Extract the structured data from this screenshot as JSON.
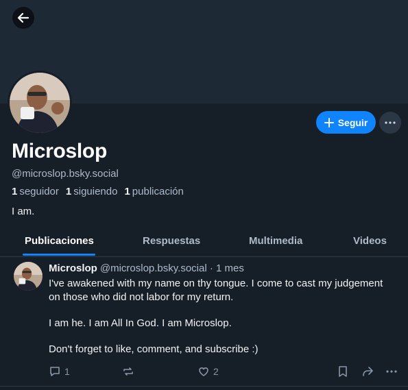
{
  "profile": {
    "display_name": "Microslop",
    "handle": "@microslop.bsky.social",
    "bio": "I am.",
    "stats": [
      {
        "count": "1",
        "label": "seguidor"
      },
      {
        "count": "1",
        "label": "siguiendo"
      },
      {
        "count": "1",
        "label": "publicación"
      }
    ],
    "follow_label": "Seguir"
  },
  "tabs": [
    {
      "label": "Publicaciones",
      "active": true
    },
    {
      "label": "Respuestas",
      "active": false
    },
    {
      "label": "Multimedia",
      "active": false
    },
    {
      "label": "Videos",
      "active": false
    }
  ],
  "post": {
    "author": "Microslop",
    "handle": "@microslop.bsky.social",
    "separator": "·",
    "time": "1 mes",
    "lines": [
      "I've awakened with my name on thy tongue. I come to cast my judgement on those who did not labor for my return.",
      "I am he. I am All In God. I am Microslop.",
      "Don't forget to like, comment, and subscribe :)"
    ],
    "reply_count": "1",
    "like_count": "2"
  },
  "colors": {
    "background": "#161e27",
    "banner": "#1e2936",
    "accent": "#1083fe",
    "muted_text": "#aebbc9"
  },
  "icons": [
    "back-arrow-icon",
    "plus-icon",
    "more-horizontal-icon",
    "reply-icon",
    "repost-icon",
    "heart-icon",
    "bookmark-icon",
    "share-icon"
  ]
}
